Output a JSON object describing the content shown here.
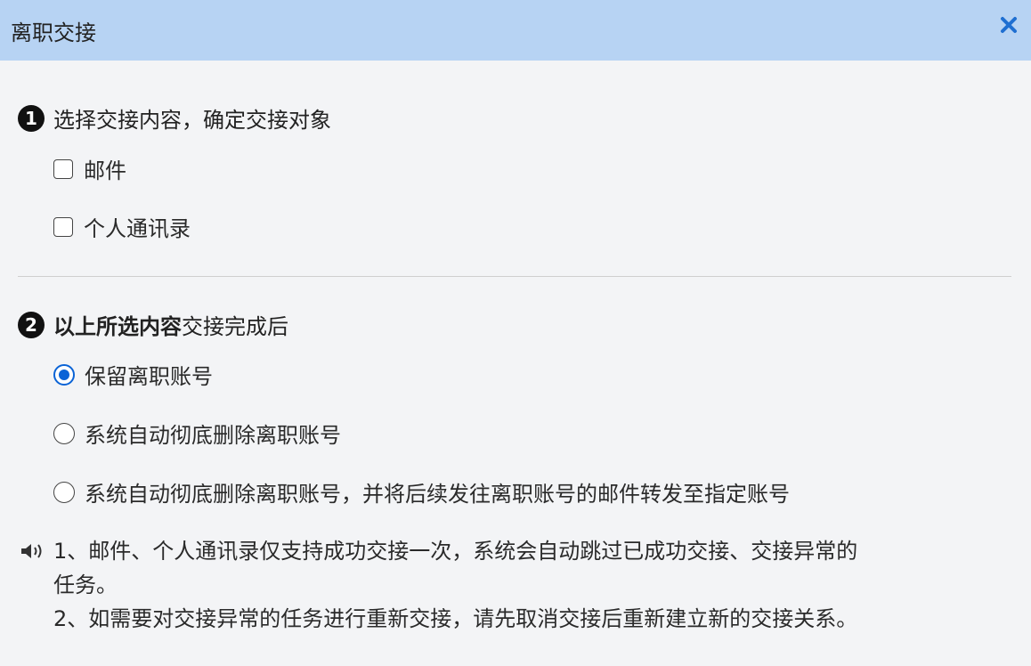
{
  "dialog": {
    "title": "离职交接",
    "close_icon": "close-icon"
  },
  "step1": {
    "number": "1",
    "title": "选择交接内容，确定交接对象",
    "options": [
      {
        "label": "邮件",
        "checked": false
      },
      {
        "label": "个人通讯录",
        "checked": false
      }
    ]
  },
  "step2": {
    "number": "2",
    "title_bold": "以上所选内容",
    "title_rest": "交接完成后",
    "options": [
      {
        "label": "保留离职账号",
        "checked": true
      },
      {
        "label": "系统自动彻底删除离职账号",
        "checked": false
      },
      {
        "label": "系统自动彻底删除离职账号，并将后续发往离职账号的邮件转发至指定账号",
        "checked": false
      }
    ]
  },
  "notice": {
    "icon": "speaker-icon",
    "line1": "1、邮件、个人通讯录仅支持成功交接一次，系统会自动跳过已成功交接、交接异常的",
    "line2": "任务。",
    "line3": "2、如需要对交接异常的任务进行重新交接，请先取消交接后重新建立新的交接关系。"
  },
  "colors": {
    "titlebar": "#b7d3f3",
    "accent": "#0a63d6",
    "background": "#f3f4f6"
  }
}
